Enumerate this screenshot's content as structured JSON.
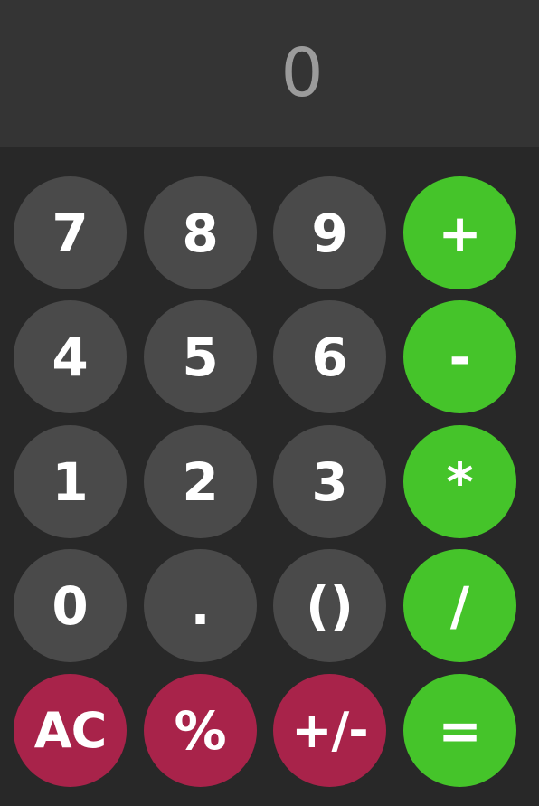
{
  "display": {
    "value": "0"
  },
  "keys": {
    "seven": "7",
    "eight": "8",
    "nine": "9",
    "plus": "+",
    "four": "4",
    "five": "5",
    "six": "6",
    "minus": "-",
    "one": "1",
    "two": "2",
    "three": "3",
    "multiply": "*",
    "zero": "0",
    "decimal": ".",
    "parentheses": "()",
    "divide": "/",
    "clear": "AC",
    "percent": "%",
    "negate": "+/-",
    "equals": "="
  },
  "colors": {
    "background": "#282828",
    "display_background": "#343434",
    "display_text": "#9b9b9b",
    "number_key": "#4a4a4a",
    "operator_key": "#45c42a",
    "function_key": "#a8234a",
    "key_text": "#ffffff"
  }
}
